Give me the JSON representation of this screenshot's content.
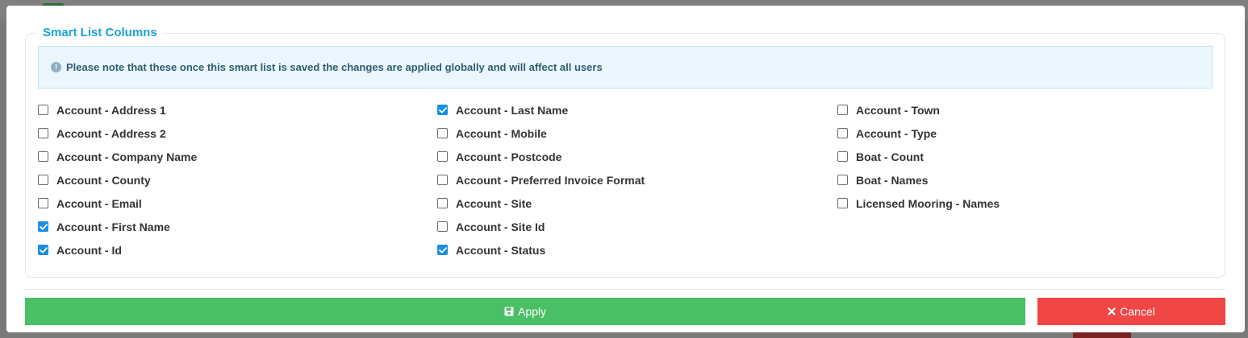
{
  "modal": {
    "legend": "Smart List Columns",
    "notice": "Please note that these once this smart list is saved the changes are applied globally and will affect all users",
    "notice_icon": "info-icon",
    "accent_color": "#1aa3dc",
    "checkbox_checked_color": "#1a8fe3"
  },
  "columns": {
    "col1": [
      {
        "label": "Account - Address 1",
        "checked": false
      },
      {
        "label": "Account - Address 2",
        "checked": false
      },
      {
        "label": "Account - Company Name",
        "checked": false
      },
      {
        "label": "Account - County",
        "checked": false
      },
      {
        "label": "Account - Email",
        "checked": false
      },
      {
        "label": "Account - First Name",
        "checked": true
      },
      {
        "label": "Account - Id",
        "checked": true
      }
    ],
    "col2": [
      {
        "label": "Account - Last Name",
        "checked": true
      },
      {
        "label": "Account - Mobile",
        "checked": false
      },
      {
        "label": "Account - Postcode",
        "checked": false
      },
      {
        "label": "Account - Preferred Invoice Format",
        "checked": false
      },
      {
        "label": "Account - Site",
        "checked": false
      },
      {
        "label": "Account - Site Id",
        "checked": false
      },
      {
        "label": "Account - Status",
        "checked": true
      }
    ],
    "col3": [
      {
        "label": "Account - Town",
        "checked": false
      },
      {
        "label": "Account - Type",
        "checked": false
      },
      {
        "label": "Boat - Count",
        "checked": false
      },
      {
        "label": "Boat - Names",
        "checked": false
      },
      {
        "label": "Licensed Mooring - Names",
        "checked": false
      }
    ]
  },
  "footer": {
    "apply_label": "Apply",
    "apply_icon": "save-icon",
    "apply_color": "#49bf66",
    "cancel_label": "Cancel",
    "cancel_icon": "close-icon",
    "cancel_color": "#f04646"
  }
}
